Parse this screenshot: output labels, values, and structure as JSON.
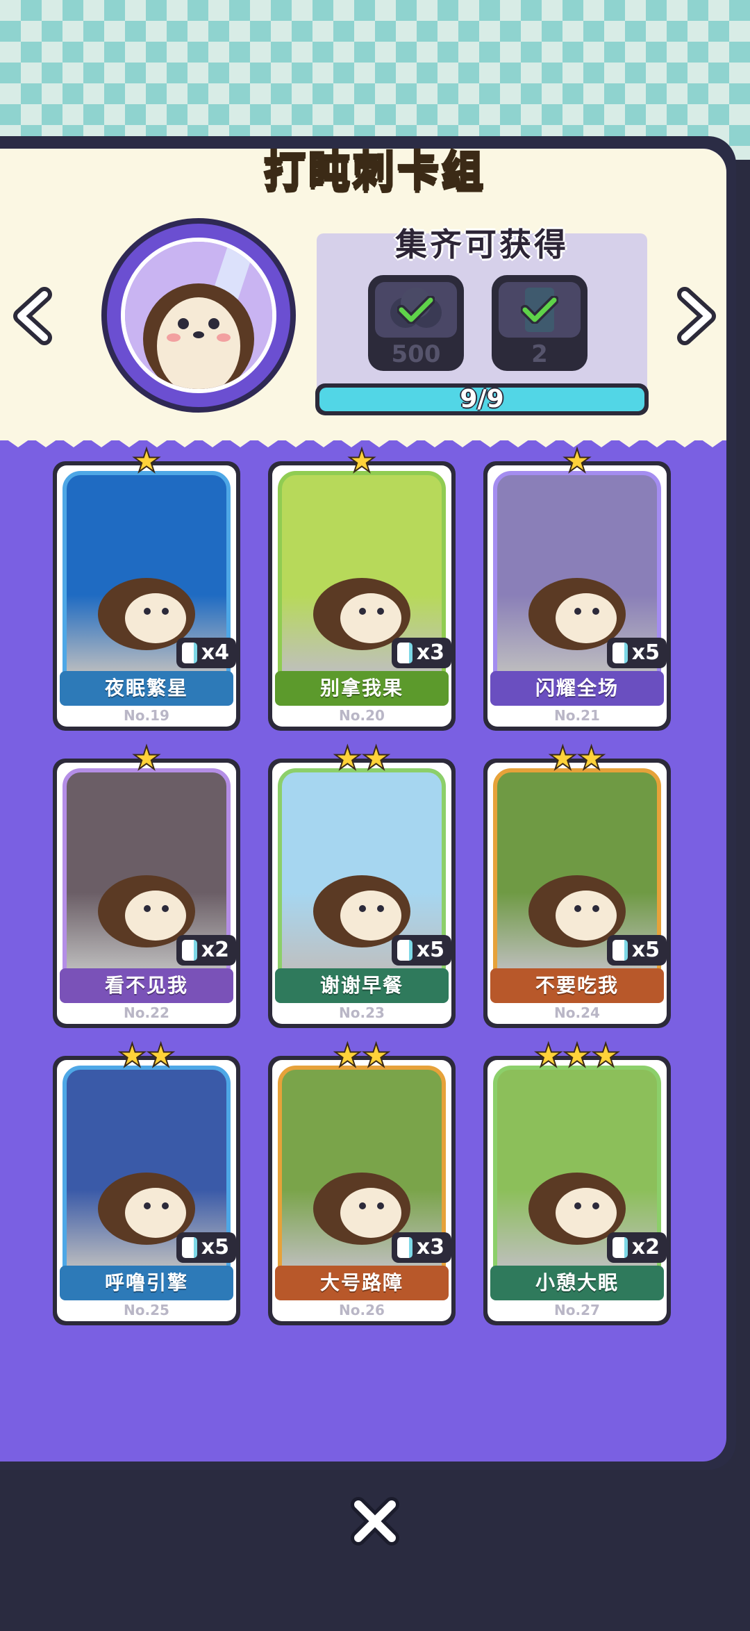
{
  "header": {
    "title": "打盹刺卡组"
  },
  "reward": {
    "title": "集齐可获得",
    "items": [
      {
        "name": "coin-bundle",
        "count": "500"
      },
      {
        "name": "card-pack",
        "count": "2"
      }
    ],
    "progress_text": "9/9",
    "progress_fraction": 1.0
  },
  "cards": [
    {
      "name": "夜眠繁星",
      "no": "No.19",
      "count": "x4",
      "stars": 1,
      "ribbon": "#2d7ab8",
      "border": "#4ea7e6",
      "art": "#1f6bc2"
    },
    {
      "name": "别拿我果",
      "no": "No.20",
      "count": "x3",
      "stars": 1,
      "ribbon": "#5c9a2c",
      "border": "#90cc52",
      "art": "#b7d95a"
    },
    {
      "name": "闪耀全场",
      "no": "No.21",
      "count": "x5",
      "stars": 1,
      "ribbon": "#6a4fc0",
      "border": "#a48df0",
      "art": "#8a7fb8"
    },
    {
      "name": "看不见我",
      "no": "No.22",
      "count": "x2",
      "stars": 1,
      "ribbon": "#7a52b8",
      "border": "#b48ee6",
      "art": "#6b5e66"
    },
    {
      "name": "谢谢早餐",
      "no": "No.23",
      "count": "x5",
      "stars": 2,
      "ribbon": "#2f7a5c",
      "border": "#8ccf6a",
      "art": "#a6d6f0"
    },
    {
      "name": "不要吃我",
      "no": "No.24",
      "count": "x5",
      "stars": 2,
      "ribbon": "#b8582a",
      "border": "#e6a23a",
      "art": "#6f9a44"
    },
    {
      "name": "呼噜引擎",
      "no": "No.25",
      "count": "x5",
      "stars": 2,
      "ribbon": "#2d7ab8",
      "border": "#4ea7e6",
      "art": "#3a5aa8"
    },
    {
      "name": "大号路障",
      "no": "No.26",
      "count": "x3",
      "stars": 2,
      "ribbon": "#b8582a",
      "border": "#e6a23a",
      "art": "#7aa44a"
    },
    {
      "name": "小憩大眠",
      "no": "No.27",
      "count": "x2",
      "stars": 3,
      "ribbon": "#2f7a5c",
      "border": "#8ccf6a",
      "art": "#8cbf5a"
    }
  ],
  "colors": {
    "accent": "#ffd23a",
    "panel": "#7a60e2",
    "header_bg": "#fbf7e3",
    "progress": "#52d6e6"
  }
}
